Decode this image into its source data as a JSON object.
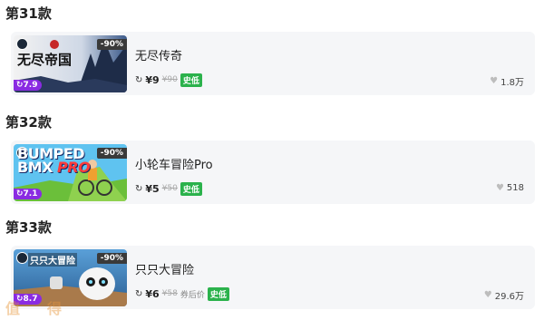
{
  "sections": [
    {
      "heading": "第31款",
      "game": {
        "thumb_caption": "无尽帝国",
        "discount": "-90%",
        "score": "7.9",
        "title": "无尽传奇",
        "price": "¥9",
        "old_price": "¥90",
        "coupon_text": "",
        "tag": "史低",
        "likes": "1.8万"
      }
    },
    {
      "heading": "第32款",
      "game": {
        "thumb_caption_line1": "BUMPED",
        "thumb_caption_line2": "BMX",
        "thumb_caption_line2b": "PRO",
        "discount": "-90%",
        "score": "7.1",
        "title": "小轮车冒险Pro",
        "price": "¥5",
        "old_price": "¥50",
        "coupon_text": "",
        "tag": "史低",
        "likes": "518"
      }
    },
    {
      "heading": "第33款",
      "game": {
        "thumb_caption": "只只大冒险",
        "discount": "-90%",
        "score": "8.7",
        "title": "只只大冒险",
        "price": "¥6",
        "old_price": "¥58",
        "coupon_text": "券后价",
        "tag": "史低",
        "likes": "29.6万"
      }
    }
  ],
  "watermark": "值得"
}
